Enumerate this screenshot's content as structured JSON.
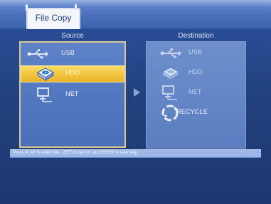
{
  "header": {
    "tab_label": "File Copy"
  },
  "columns": {
    "source_title": "Source",
    "destination_title": "Destination"
  },
  "source": {
    "items": [
      {
        "label": "USB",
        "icon": "usb-icon"
      },
      {
        "label": "HDD",
        "icon": "hdd-icon",
        "selected": true
      },
      {
        "label": "NET",
        "icon": "network-icon"
      }
    ]
  },
  "destination": {
    "items": [
      {
        "label": "USB",
        "icon": "usb-icon"
      },
      {
        "label": "HDD",
        "icon": "hdd-icon"
      },
      {
        "label": "NET",
        "icon": "network-icon"
      },
      {
        "label": "RECYCLE",
        "icon": "recycle-icon"
      }
    ]
  },
  "status": {
    "help_text": "Press PLAY to select file, LEFT to cancel, and RIGHT to next step."
  },
  "colors": {
    "background": "#22427f",
    "highlight": "#f1c43c",
    "panel_border": "#d9c78f"
  }
}
